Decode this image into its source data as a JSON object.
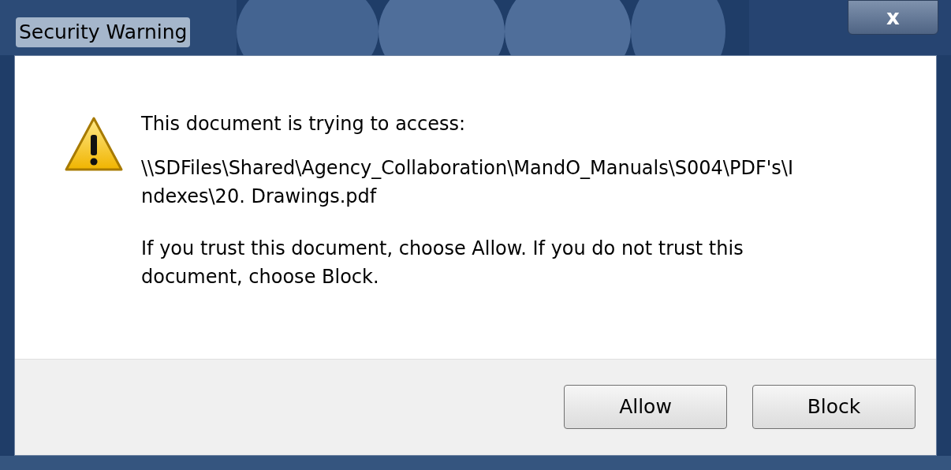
{
  "window": {
    "title": "Security Warning",
    "close": "x"
  },
  "message": {
    "heading": "This document is trying to access:",
    "path_lines": [
      "\\\\SDFiles\\Shared\\Agency_Collaboration\\MandO_Manuals\\S004\\PDF's\\I",
      "ndexes\\20. Drawings.pdf"
    ],
    "advice_lines": [
      "If you trust this document, choose Allow. If you do not trust this",
      "document, choose Block."
    ]
  },
  "buttons": [
    {
      "label": "Allow",
      "selected": false
    },
    {
      "label": "Block",
      "selected": false
    }
  ]
}
